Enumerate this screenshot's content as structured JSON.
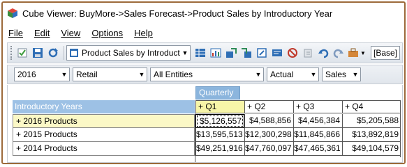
{
  "window": {
    "title": "Cube Viewer: BuyMore->Sales Forecast->Product Sales by Introductory Year"
  },
  "menu": [
    "File",
    "Edit",
    "View",
    "Options",
    "Help"
  ],
  "toolbar": {
    "view_name": "Product Sales by Introducton",
    "base_label": "[Base]"
  },
  "dimensions": [
    {
      "value": "2016"
    },
    {
      "value": "Retail"
    },
    {
      "value": "All Entities"
    },
    {
      "value": "Actual"
    },
    {
      "value": "Sales"
    }
  ],
  "grid": {
    "column_dimension": "Quarterly",
    "row_dimension": "Introductory Years",
    "columns": [
      "+ Q1",
      "+ Q2",
      "+ Q3",
      "+ Q4"
    ],
    "rows": [
      {
        "label": "+ 2016 Products",
        "values": [
          "$5,126,557",
          "$4,588,856",
          "$4,456,384",
          "$5,205,588"
        ]
      },
      {
        "label": "+ 2015 Products",
        "values": [
          "$13,595,513",
          "$12,300,298",
          "$11,845,866",
          "$13,892,819"
        ]
      },
      {
        "label": "+ 2014 Products",
        "values": [
          "$49,251,916",
          "$47,760,097",
          "$47,465,361",
          "$49,104,579"
        ]
      }
    ]
  }
}
